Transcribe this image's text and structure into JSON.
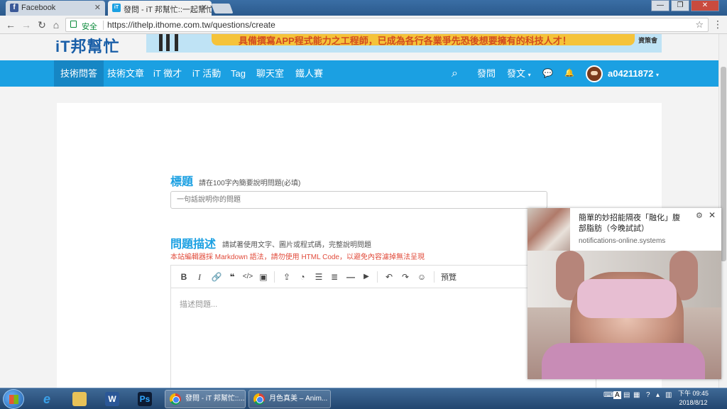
{
  "browser": {
    "tabs": [
      {
        "title": "Facebook",
        "favicon": "f"
      },
      {
        "title": "發問 - iT 邦幫忙::一起幫忙",
        "favicon": "iT"
      }
    ],
    "secure_label": "安全",
    "url": "https://ithelp.ithome.com.tw/questions/create"
  },
  "site": {
    "logo": "iT邦幫忙",
    "banner_text": "具備撰寫APP程式能力之工程師，已成為各行各業爭先恐後想要擁有的科技人才！",
    "banner_brand": "資策會",
    "nav": [
      {
        "label": "技術問答"
      },
      {
        "label": "技術文章"
      },
      {
        "label": "iT 徵才"
      },
      {
        "label": "iT 活動"
      },
      {
        "label": "Tag"
      },
      {
        "label": "聊天室"
      },
      {
        "label": "鐵人賽"
      }
    ],
    "nav_right": {
      "ask": "發問",
      "post": "發文",
      "username": "a04211872"
    }
  },
  "form": {
    "title_label": "標題",
    "title_hint": "請在100字內簡要說明問題(必填)",
    "title_placeholder": "一句話說明你的問題",
    "desc_label": "問題描述",
    "desc_hint": "請試著使用文字、圖片或程式碼，完整說明問題",
    "warning": "本站編輯器採 Markdown 語法，請勿使用 HTML Code，以避免內容濾掉無法呈現",
    "preview": "預覽",
    "desc_placeholder": "描述問題..."
  },
  "notification": {
    "message": "簡單的妙招能隔夜「融化」腹部脂肪（今晚試試）",
    "source": "notifications-online.systems"
  },
  "taskbar": {
    "tasks": [
      {
        "title": "發問 - iT 邦幫忙::..."
      },
      {
        "title": "月色真美 – Anim..."
      }
    ],
    "time": "下午 09:45",
    "date": "2018/8/12",
    "ime": "A"
  },
  "colors": {
    "nav_blue": "#1ba0e2",
    "warning_red": "#e14b3b"
  }
}
